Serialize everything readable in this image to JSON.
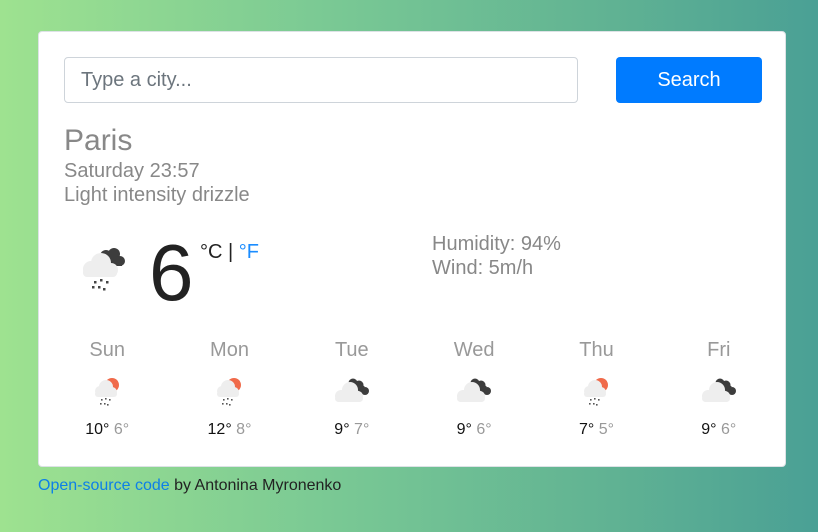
{
  "search": {
    "placeholder": "Type a city...",
    "value": "",
    "button_label": "Search"
  },
  "current": {
    "city": "Paris",
    "datetime": "Saturday 23:57",
    "description": "Light intensity drizzle",
    "icon": "night-cloud-drizzle-icon",
    "temperature": "6",
    "unit_celsius": "°C",
    "unit_separator": "|",
    "unit_fahrenheit": "°F",
    "humidity": "Humidity: 94%",
    "wind": "Wind: 5m/h"
  },
  "forecast": [
    {
      "day": "Sun",
      "icon": "sun-cloud-rain-icon",
      "max": "10°",
      "min": "6°"
    },
    {
      "day": "Mon",
      "icon": "sun-cloud-rain-icon",
      "max": "12°",
      "min": "8°"
    },
    {
      "day": "Tue",
      "icon": "cloudy-icon",
      "max": "9°",
      "min": "7°"
    },
    {
      "day": "Wed",
      "icon": "cloudy-icon",
      "max": "9°",
      "min": "6°"
    },
    {
      "day": "Thu",
      "icon": "sun-cloud-rain-icon",
      "max": "7°",
      "min": "5°"
    },
    {
      "day": "Fri",
      "icon": "cloudy-icon",
      "max": "9°",
      "min": "6°"
    }
  ],
  "footer": {
    "link_text": "Open-source code",
    "suffix": " by Antonina Myronenko"
  },
  "colors": {
    "accent": "#007bff",
    "link": "#0d7fe8",
    "sun": "#f06a4a",
    "dark_cloud": "#3d3d3d",
    "light_cloud": "#eeeeee"
  }
}
